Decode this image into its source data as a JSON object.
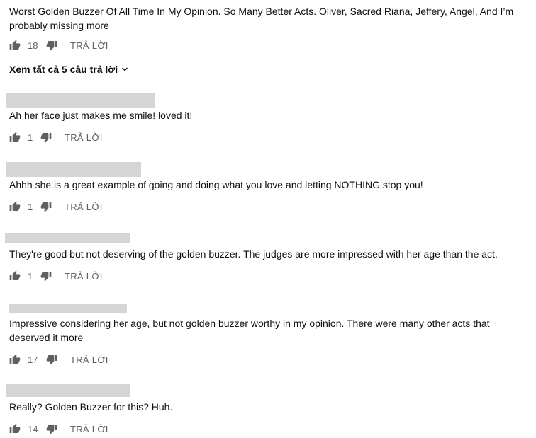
{
  "comments": [
    {
      "text": "Worst Golden Buzzer Of All Time In My Opinion. So Many Better Acts. Oliver, Sacred Riana, Jeffery, Angel, And I’m probably missing more",
      "likes": "18",
      "reply_label": "TRẢ LỜI",
      "view_replies_label": "Xem tất cả 5 câu trả lời"
    },
    {
      "text": "Ah her face just makes me smile!  loved it!",
      "likes": "1",
      "reply_label": "TRẢ LỜI"
    },
    {
      "text": "Ahhh she is a great example of going and doing what you love and letting NOTHING stop you!",
      "likes": "1",
      "reply_label": "TRẢ LỜI"
    },
    {
      "text": "They're good but not deserving of the golden buzzer. The judges are more impressed with her age than the act.",
      "likes": "1",
      "reply_label": "TRẢ LỜI"
    },
    {
      "text": "Impressive considering her age, but not golden buzzer worthy in my opinion. There were many other acts that deserved it more",
      "likes": "17",
      "reply_label": "TRẢ LỜI"
    },
    {
      "text": "Really? Golden Buzzer for this? Huh.",
      "likes": "14",
      "reply_label": "TRẢ LỜI"
    }
  ],
  "icons": {
    "like": "thumb-up-icon",
    "dislike": "thumb-down-icon",
    "expand": "chevron-down-icon"
  },
  "colors": {
    "text": "#0f0f0f",
    "secondary": "#606060",
    "redacted": "#d5d5d5"
  }
}
